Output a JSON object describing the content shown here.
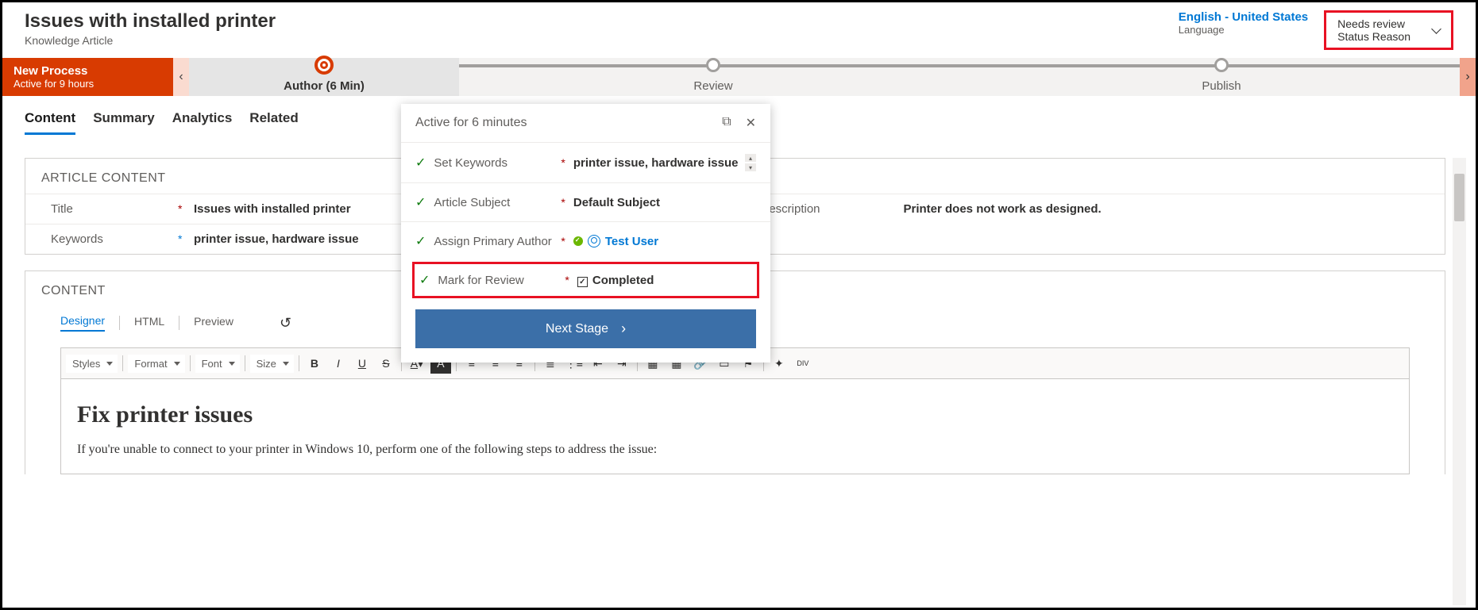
{
  "header": {
    "title": "Issues with installed printer",
    "subtitle": "Knowledge Article",
    "language_value": "English - United States",
    "language_label": "Language",
    "status_value": "Needs review",
    "status_label": "Status Reason"
  },
  "process": {
    "name": "New Process",
    "active_for": "Active for 9 hours",
    "stages": [
      {
        "label": "Author  (6 Min)",
        "active": true
      },
      {
        "label": "Review",
        "active": false
      },
      {
        "label": "Publish",
        "active": false
      }
    ]
  },
  "tabs": [
    "Content",
    "Summary",
    "Analytics",
    "Related"
  ],
  "article": {
    "section_title": "ARTICLE CONTENT",
    "title_label": "Title",
    "title_value": "Issues with installed printer",
    "keywords_label": "Keywords",
    "keywords_value": "printer issue, hardware issue",
    "description_label": "Description",
    "description_value": "Printer does not work as designed."
  },
  "content": {
    "section_title": "CONTENT",
    "editor_tabs": [
      "Designer",
      "HTML",
      "Preview"
    ],
    "toolbar_selects": [
      "Styles",
      "Format",
      "Font",
      "Size"
    ],
    "body_heading": "Fix printer issues",
    "body_paragraph": "If you're unable to connect to your printer in Windows 10, perform one of the following steps to address the issue:"
  },
  "flyout": {
    "title": "Active for 6 minutes",
    "rows": [
      {
        "label": "Set Keywords",
        "value": "printer issue, hardware issue",
        "type": "text"
      },
      {
        "label": "Article Subject",
        "value": "Default Subject",
        "type": "text"
      },
      {
        "label": "Assign Primary Author",
        "value": "Test User",
        "type": "user"
      },
      {
        "label": "Mark for Review",
        "value": "Completed",
        "type": "check"
      }
    ],
    "next_stage": "Next Stage"
  }
}
